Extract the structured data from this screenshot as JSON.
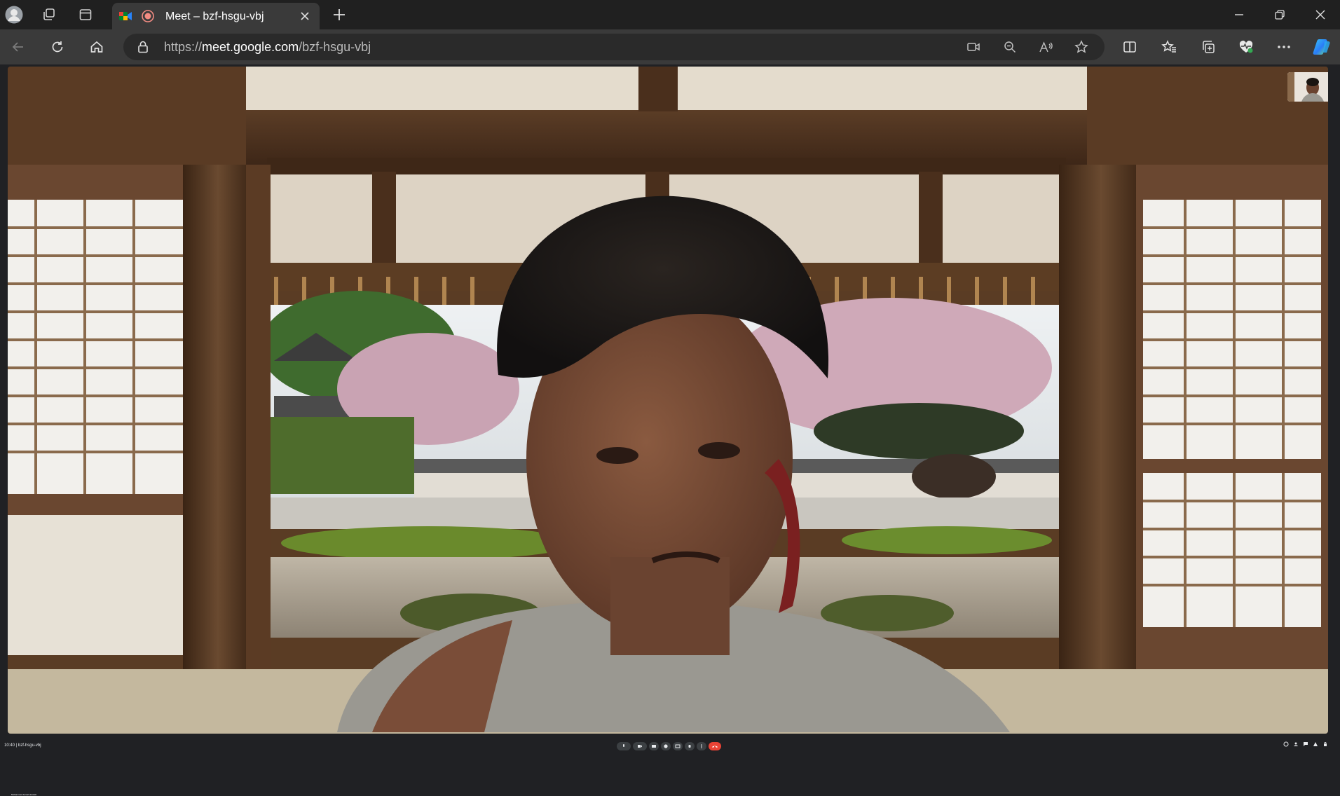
{
  "browser": {
    "tab": {
      "title": "Meet – bzf-hsgu-vbj"
    },
    "address": {
      "scheme": "https://",
      "host": "meet.google.com",
      "path": "/bzf-hsgu-vbj"
    },
    "colors": {
      "tabstrip": "#202020",
      "toolbar": "#3a3a3a",
      "omnibox": "#2a2a2a"
    },
    "toolbar_icons": [
      "back-icon",
      "refresh-icon",
      "home-icon",
      "lock-icon",
      "camera-icon",
      "zoom-out-icon",
      "read-aloud-icon",
      "favorite-star-icon",
      "split-screen-icon",
      "favorites-icon",
      "collections-icon",
      "browser-essentials-icon",
      "more-options-icon",
      "copilot-icon"
    ]
  },
  "meet": {
    "participant_name": "Mohammed Jamal Hossain",
    "meeting_time": "10:40",
    "meeting_code": "bzf-hsgu-vbj",
    "colors": {
      "end_call": "#ea4335",
      "background": "#202124"
    }
  }
}
